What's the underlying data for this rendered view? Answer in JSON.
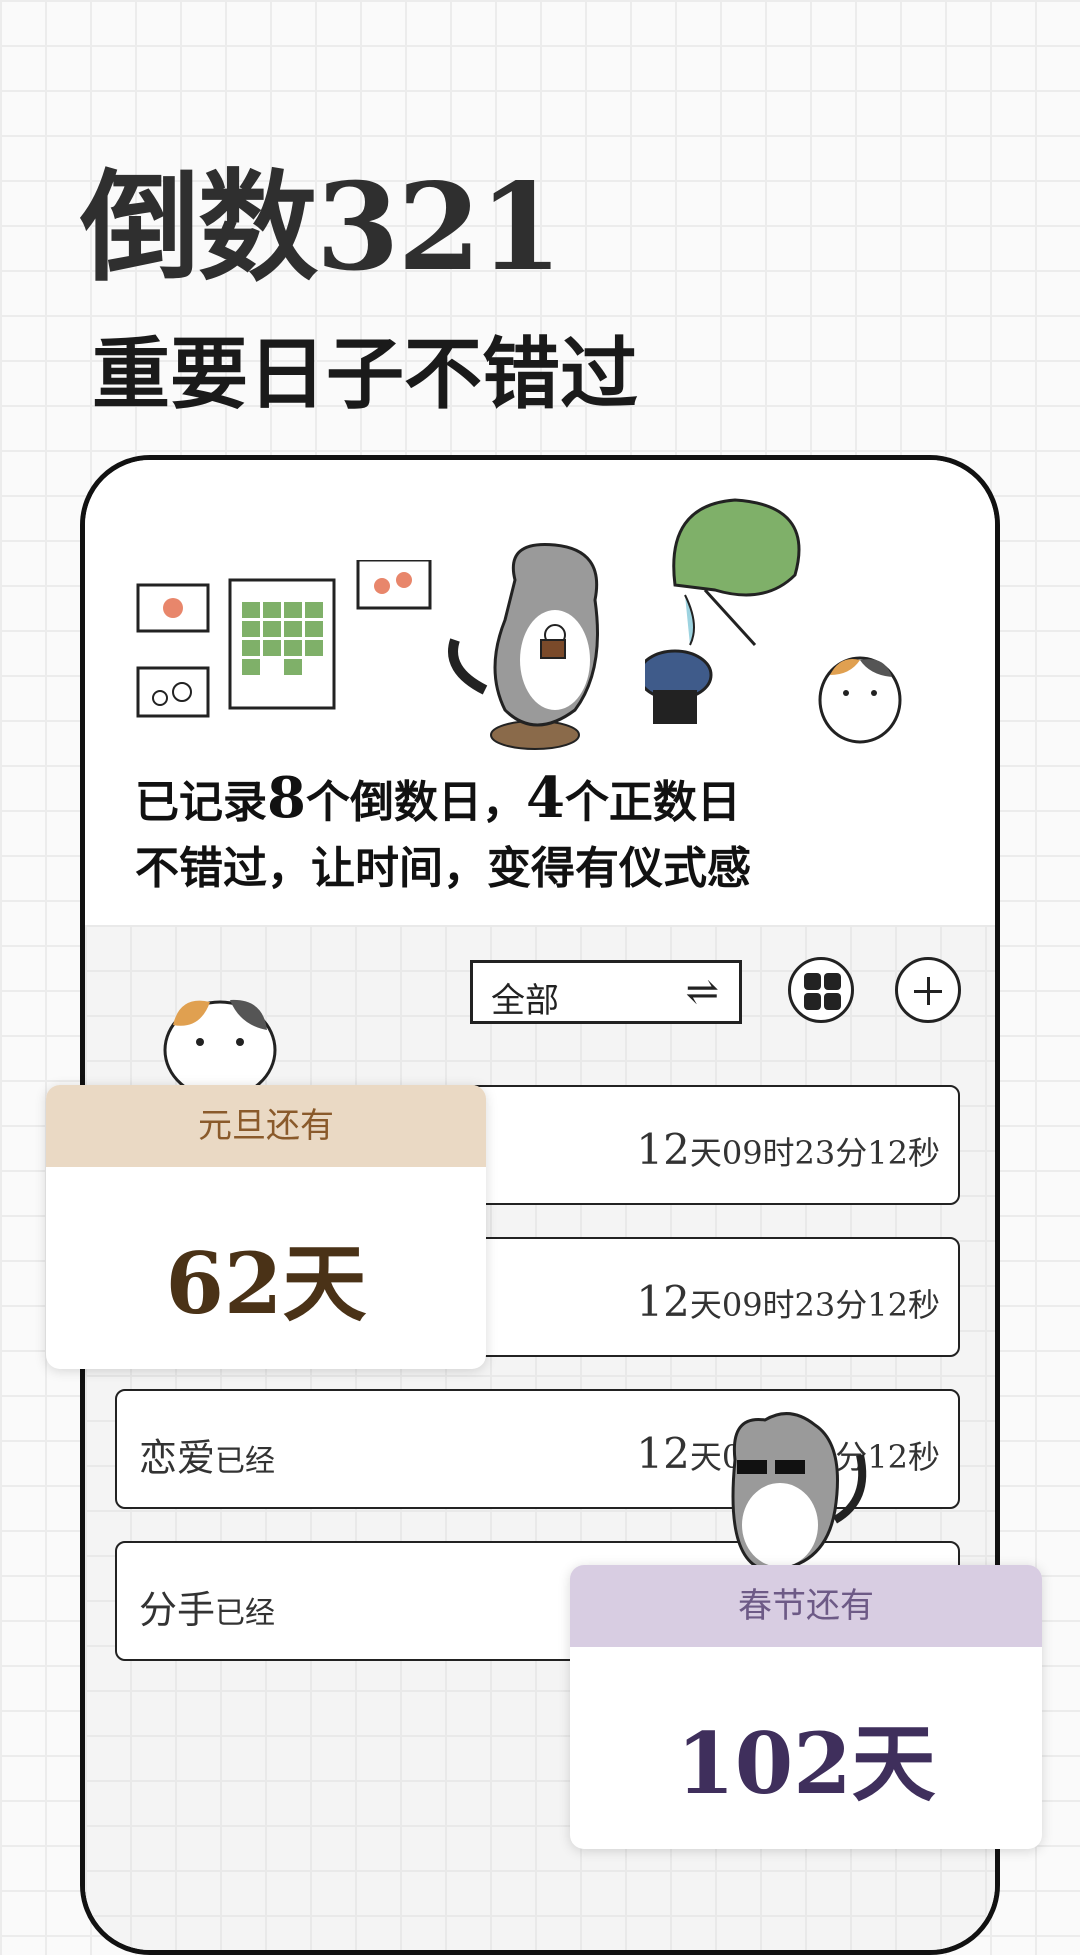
{
  "header": {
    "title": "倒数321",
    "subtitle": "重要日子不错过"
  },
  "summary": {
    "part1": "已记录",
    "count_countdown": "8",
    "part2": "个倒数日，",
    "count_countup": "4",
    "part3": "个正数日",
    "line2": "不错过，让时间，变得有仪式感"
  },
  "toolbar": {
    "filter_label": "全部",
    "filter_icon": "⇌",
    "grid_icon": "grid-icon",
    "add_icon": "plus-icon"
  },
  "rows": [
    {
      "name": "",
      "suffix": "",
      "num": "12",
      "rest": "天09时23分12秒"
    },
    {
      "name": "",
      "suffix": "",
      "num": "12",
      "rest": "天09时23分12秒"
    },
    {
      "name": "恋爱",
      "suffix": "已经",
      "num": "12",
      "rest": "天09时23分12秒"
    },
    {
      "name": "分手",
      "suffix": "已经",
      "num": "",
      "rest": ""
    }
  ],
  "cards": [
    {
      "title": "元旦还有",
      "value": "62天",
      "head_color": "#ead9c4",
      "title_color": "#8a5a2b",
      "value_color": "#4a3217"
    },
    {
      "title": "春节还有",
      "value": "102天",
      "head_color": "#d8cde2",
      "title_color": "#6d5a86",
      "value_color": "#3f2f5c"
    }
  ]
}
